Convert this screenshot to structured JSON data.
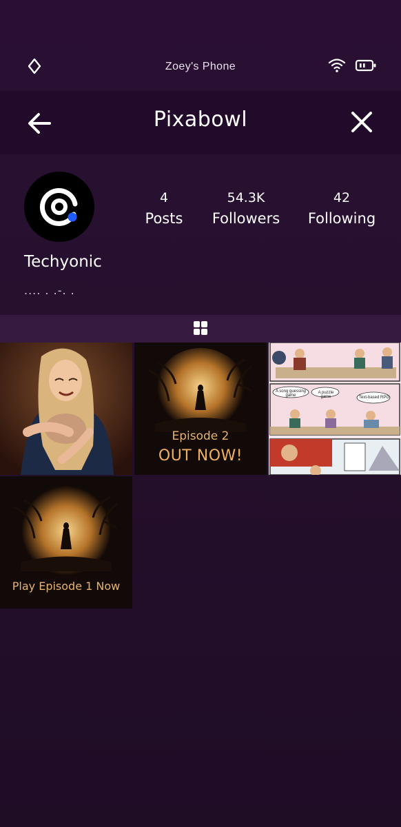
{
  "status_bar": {
    "device_name": "Zoey's Phone"
  },
  "app_bar": {
    "title": "Pixabowl"
  },
  "profile": {
    "username": "Techyonic",
    "bio": ".... . .-. .",
    "stats": [
      {
        "value": "4",
        "label": "Posts"
      },
      {
        "value": "54.3K",
        "label": "Followers"
      },
      {
        "value": "42",
        "label": "Following"
      }
    ]
  },
  "posts": [
    {
      "captions": []
    },
    {
      "captions": [
        "Episode 2",
        "OUT NOW!"
      ]
    },
    {
      "meme_labels": [
        "A song guessing game",
        "A puzzle game",
        "Text-based RPG"
      ]
    },
    {
      "captions": [
        "Play Episode 1 Now"
      ]
    }
  ],
  "colors": {
    "accent_blue": "#1f5bff",
    "caption_gold": "#e6b46e",
    "app_bar": "#220b2a",
    "grid_tab": "#361a3f"
  }
}
